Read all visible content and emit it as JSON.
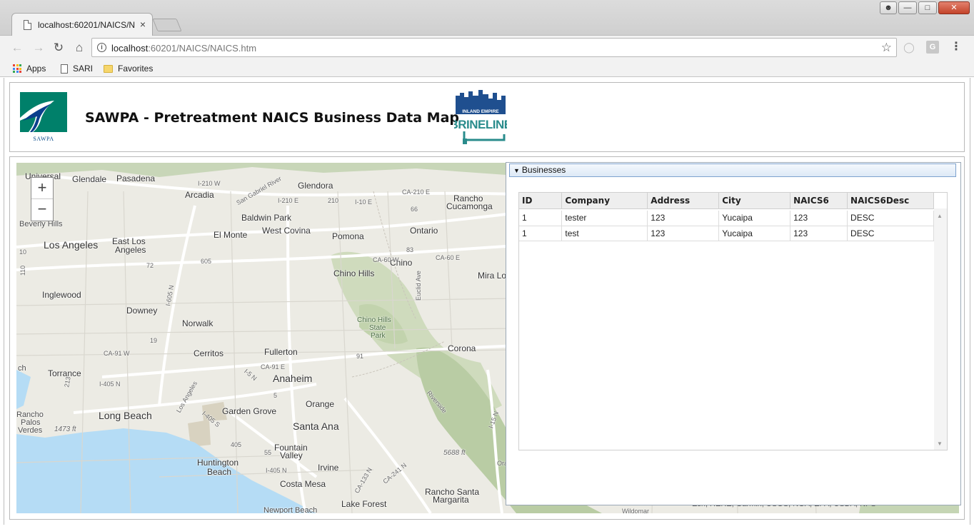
{
  "browser": {
    "tab_title": "localhost:60201/NAICS/N",
    "tab_close": "×",
    "url_host": "localhost",
    "url_path": ":60201/NAICS/NAICS.htm",
    "bookmarks": [
      {
        "label": "Apps",
        "icon": "apps-grid-icon"
      },
      {
        "label": "SARI",
        "icon": "page-icon"
      },
      {
        "label": "Favorites",
        "icon": "folder-icon"
      }
    ],
    "ext_g": "G"
  },
  "header": {
    "title": "SAWPA - Pretreatment NAICS Business Data Map",
    "sawpa_logo_text": "SAWPA",
    "brine_logo_top": "INLAND EMPIRE",
    "brine_logo_main": "BRINELINE"
  },
  "map": {
    "zoom_in": "+",
    "zoom_out": "−",
    "attribution": "Esri, HERE, Garmin, USGS, NGA, EPA, USDA, NPS",
    "labels": {
      "universal": "Universal",
      "glendale": "Glendale",
      "pasadena": "Pasadena",
      "glendora": "Glendora",
      "arcadia": "Arcadia",
      "rancho_cucamonga_1": "Rancho",
      "rancho_cucamonga_2": "Cucamonga",
      "baldwin_park": "Baldwin Park",
      "beverly_hills": "Beverly Hills",
      "el_monte": "El Monte",
      "west_covina": "West Covina",
      "pomona": "Pomona",
      "ontario": "Ontario",
      "los_angeles": "Los Angeles",
      "east_la_1": "East Los",
      "east_la_2": "Angeles",
      "chino": "Chino",
      "chino_hills": "Chino Hills",
      "mira_loma": "Mira Lo",
      "inglewood": "Inglewood",
      "downey": "Downey",
      "norwalk": "Norwalk",
      "chino_hills_sp_1": "Chino Hills",
      "chino_hills_sp_2": "State",
      "chino_hills_sp_3": "Park",
      "cerritos": "Cerritos",
      "fullerton": "Fullerton",
      "corona": "Corona",
      "torrance": "Torrance",
      "anaheim": "Anaheim",
      "orange": "Orange",
      "rancho_palos_1": "Rancho",
      "rancho_palos_2": "Palos",
      "rancho_palos_3": "Verdes",
      "elev_1473": "1473 ft",
      "long_beach": "Long Beach",
      "garden_grove": "Garden Grove",
      "santa_ana": "Santa Ana",
      "elev_5688": "5688 ft",
      "fountain_valley_1": "Fountain",
      "fountain_valley_2": "Valley",
      "huntington_beach_1": "Huntington",
      "huntington_beach_2": "Beach",
      "irvine": "Irvine",
      "costa_mesa": "Costa Mesa",
      "rancho_santa_margarita_1": "Rancho Santa",
      "rancho_santa_margarita_2": "Margarita",
      "newport_beach": "Newport Beach",
      "lake_forest": "Lake Forest",
      "ch": "ch",
      "i210w": "I-210 W",
      "i210e_a": "I-210 E",
      "i210e_b": "CA-210 E",
      "r210": "210",
      "i10e": "I-10 E",
      "r66": "66",
      "ca60w": "CA-60 W",
      "ca60e": "CA-60 E",
      "r83": "83",
      "euclid": "Euclid Ave",
      "r72": "72",
      "r605": "605",
      "i605n": "I-605 N",
      "r19": "19",
      "ca91w": "CA-91 W",
      "ca91e": "CA-91 E",
      "r91": "91",
      "i5n": "I-5 N",
      "r5": "5",
      "r213": "213",
      "i405n_a": "I-405 N",
      "i405s": "I-405 S",
      "r405": "405",
      "i405n_b": "I-405 N",
      "i15n": "I-15 N",
      "ca241": "CA-241 N",
      "ca133": "CA-133 N",
      "r55": "55",
      "riverside": "Riverside",
      "los_angeles_river": "Los Angeles",
      "san_gabriel": "San Gabriel River",
      "r10": "10",
      "r110": "110",
      "orange_right": "Orange",
      "wildomar": "Wildomar"
    }
  },
  "grid": {
    "panel_title": "Businesses",
    "columns": [
      "ID",
      "Company",
      "Address",
      "City",
      "NAICS6",
      "NAICS6Desc"
    ],
    "rows": [
      [
        "1",
        "tester",
        "123",
        "Yucaipa",
        "123",
        "DESC"
      ],
      [
        "1",
        "test",
        "123",
        "Yucaipa",
        "123",
        "DESC"
      ]
    ]
  },
  "colors": {
    "accent": "#7da2ce",
    "sawpa_teal": "#00806a",
    "sawpa_blue": "#0a4c8c",
    "brine_blue": "#1f4f8f",
    "water": "#b5dcf5"
  }
}
